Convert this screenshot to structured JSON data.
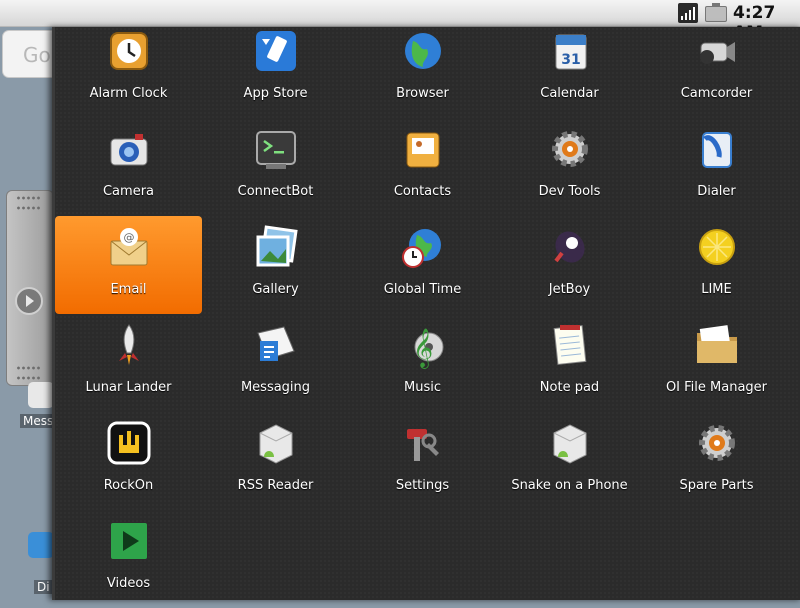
{
  "status_bar": {
    "time": "4:27 AM",
    "signal_icon": "signal-icon",
    "battery_icon": "battery-icon"
  },
  "home": {
    "search_hint": "Go",
    "side_labels": [
      "Mess",
      "Di"
    ]
  },
  "drawer": {
    "selected": "Email",
    "apps": [
      {
        "label": "Alarm Clock",
        "icon": "alarm-clock-icon"
      },
      {
        "label": "App Store",
        "icon": "app-store-icon"
      },
      {
        "label": "Browser",
        "icon": "globe-icon"
      },
      {
        "label": "Calendar",
        "icon": "calendar-icon"
      },
      {
        "label": "Camcorder",
        "icon": "camcorder-icon"
      },
      {
        "label": "Camera",
        "icon": "camera-icon"
      },
      {
        "label": "ConnectBot",
        "icon": "terminal-icon"
      },
      {
        "label": "Contacts",
        "icon": "contacts-icon"
      },
      {
        "label": "Dev Tools",
        "icon": "gear-icon"
      },
      {
        "label": "Dialer",
        "icon": "phone-icon"
      },
      {
        "label": "Email",
        "icon": "email-icon"
      },
      {
        "label": "Gallery",
        "icon": "gallery-icon"
      },
      {
        "label": "Global Time",
        "icon": "global-time-icon"
      },
      {
        "label": "JetBoy",
        "icon": "jetboy-icon"
      },
      {
        "label": "LIME",
        "icon": "lime-icon"
      },
      {
        "label": "Lunar Lander",
        "icon": "rocket-icon"
      },
      {
        "label": "Messaging",
        "icon": "messaging-icon"
      },
      {
        "label": "Music",
        "icon": "music-icon"
      },
      {
        "label": "Note pad",
        "icon": "notepad-icon"
      },
      {
        "label": "OI File Manager",
        "icon": "folder-icon"
      },
      {
        "label": "RockOn",
        "icon": "rockon-icon"
      },
      {
        "label": "RSS Reader",
        "icon": "android-box-icon"
      },
      {
        "label": "Settings",
        "icon": "settings-tools-icon"
      },
      {
        "label": "Snake on a Phone",
        "icon": "android-box-icon"
      },
      {
        "label": "Spare Parts",
        "icon": "gear-icon"
      },
      {
        "label": "Videos",
        "icon": "play-icon"
      }
    ]
  }
}
